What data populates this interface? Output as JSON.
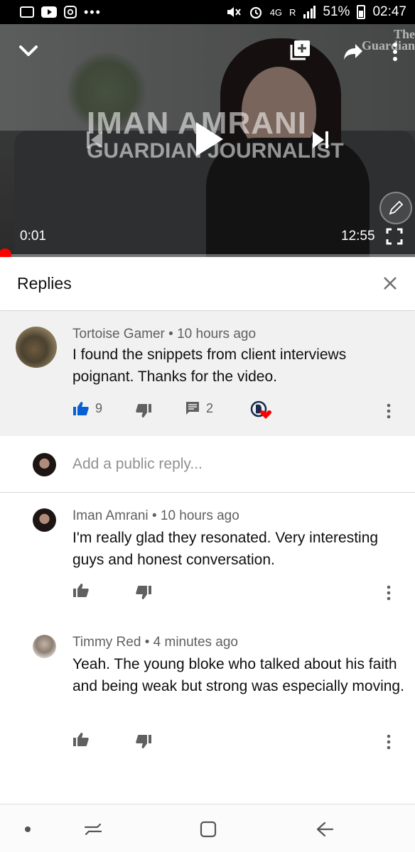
{
  "status_bar": {
    "network": "4G",
    "roaming": "R",
    "battery": "51%",
    "time": "02:47",
    "icons": [
      "image-icon",
      "youtube-icon",
      "instagram-icon",
      "more-dots-icon",
      "mute-icon",
      "alarm-icon",
      "signal-icon",
      "battery-icon"
    ]
  },
  "video": {
    "title_line1": "IMAN AMRANI",
    "title_line2": "GUARDIAN JOURNALIST",
    "watermark": "The Guardian",
    "current_time": "0:01",
    "duration": "12:55",
    "progress_fraction": 0.0013,
    "colors": {
      "progress": "#ff0000"
    }
  },
  "panel": {
    "title": "Replies"
  },
  "parent_comment": {
    "author": "Tortoise Gamer",
    "age": "10 hours ago",
    "separator": "•",
    "text": "I found the snippets from client interviews poignant. Thanks for the video.",
    "likes": "9",
    "replies": "2",
    "colors": {
      "like_active": "#065fd4",
      "heart": "#ff0000",
      "background": "#f1f1f1"
    }
  },
  "add_reply": {
    "placeholder": "Add a public reply..."
  },
  "replies": [
    {
      "author": "Iman Amrani",
      "age": "10 hours ago",
      "text": "I'm really glad they resonated. Very interesting guys and honest conversation."
    },
    {
      "author": "Timmy Red",
      "age": "4 minutes ago",
      "text": "Yeah. The young bloke who talked about his faith and being weak but strong  was especially moving."
    }
  ],
  "nav_bar": {
    "icons": [
      "nav-dot-icon",
      "recent-apps-icon",
      "home-icon",
      "back-icon"
    ]
  }
}
